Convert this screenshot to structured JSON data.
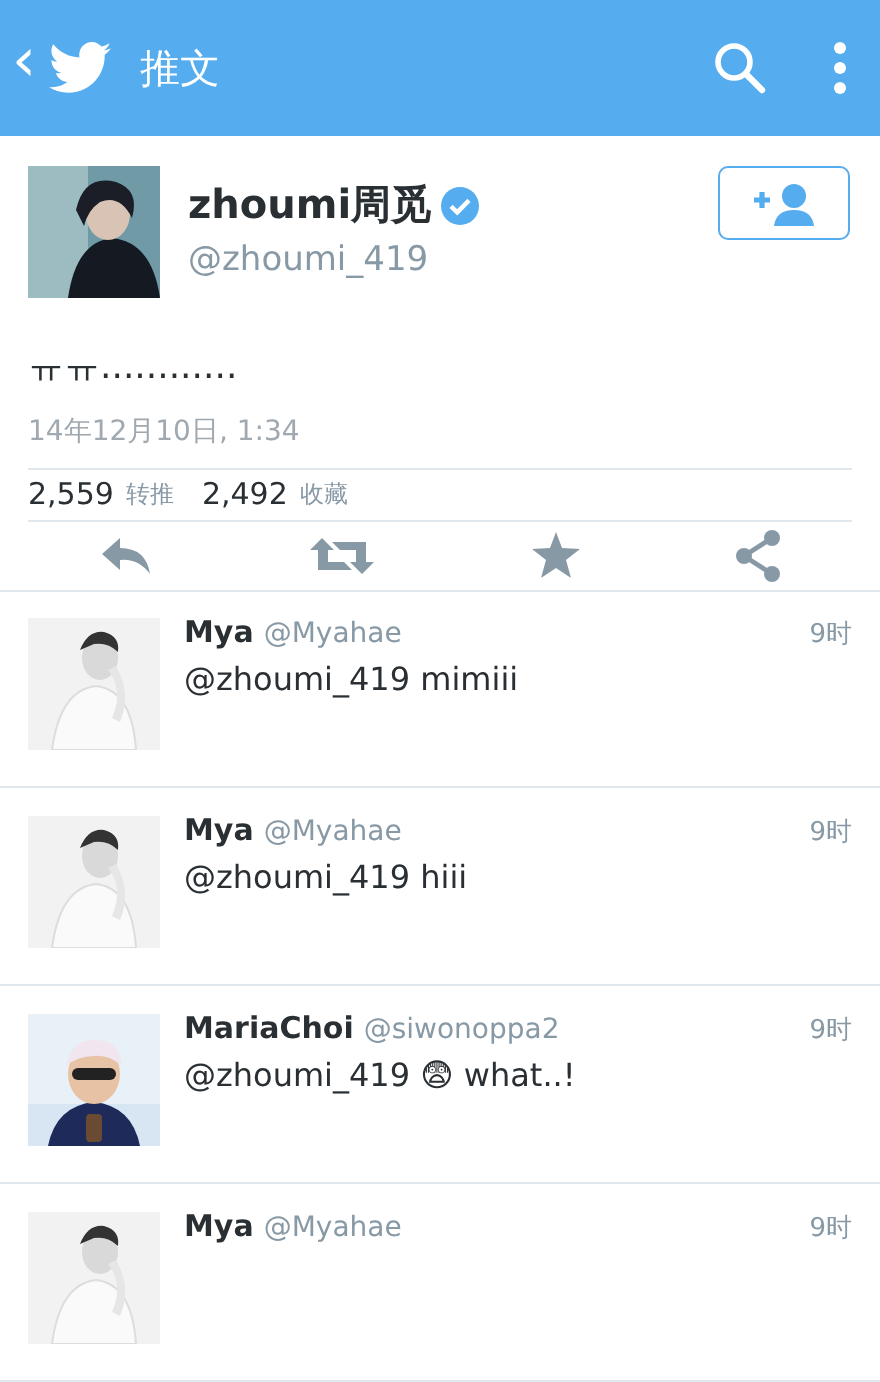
{
  "header": {
    "back": "‹",
    "title": "推文"
  },
  "tweet": {
    "name": "zhoumi周觅",
    "verified": true,
    "handle": "@zhoumi_419",
    "text": "ㅠㅠ............",
    "date": "14年12月10日, 1:34",
    "retweets": "2,559",
    "retweets_label": "转推",
    "favorites": "2,492",
    "favorites_label": "收藏"
  },
  "replies": [
    {
      "name": "Mya",
      "handle": "@Myahae",
      "time": "9时",
      "text": "@zhoumi_419 mimiii"
    },
    {
      "name": "Mya",
      "handle": "@Myahae",
      "time": "9时",
      "text": "@zhoumi_419 hiii"
    },
    {
      "name": "MariaChoi",
      "handle": "@siwonoppa2",
      "time": "9时",
      "text": "@zhoumi_419 😨 what..!"
    },
    {
      "name": "Mya",
      "handle": "@Myahae",
      "time": "9时"
    }
  ]
}
